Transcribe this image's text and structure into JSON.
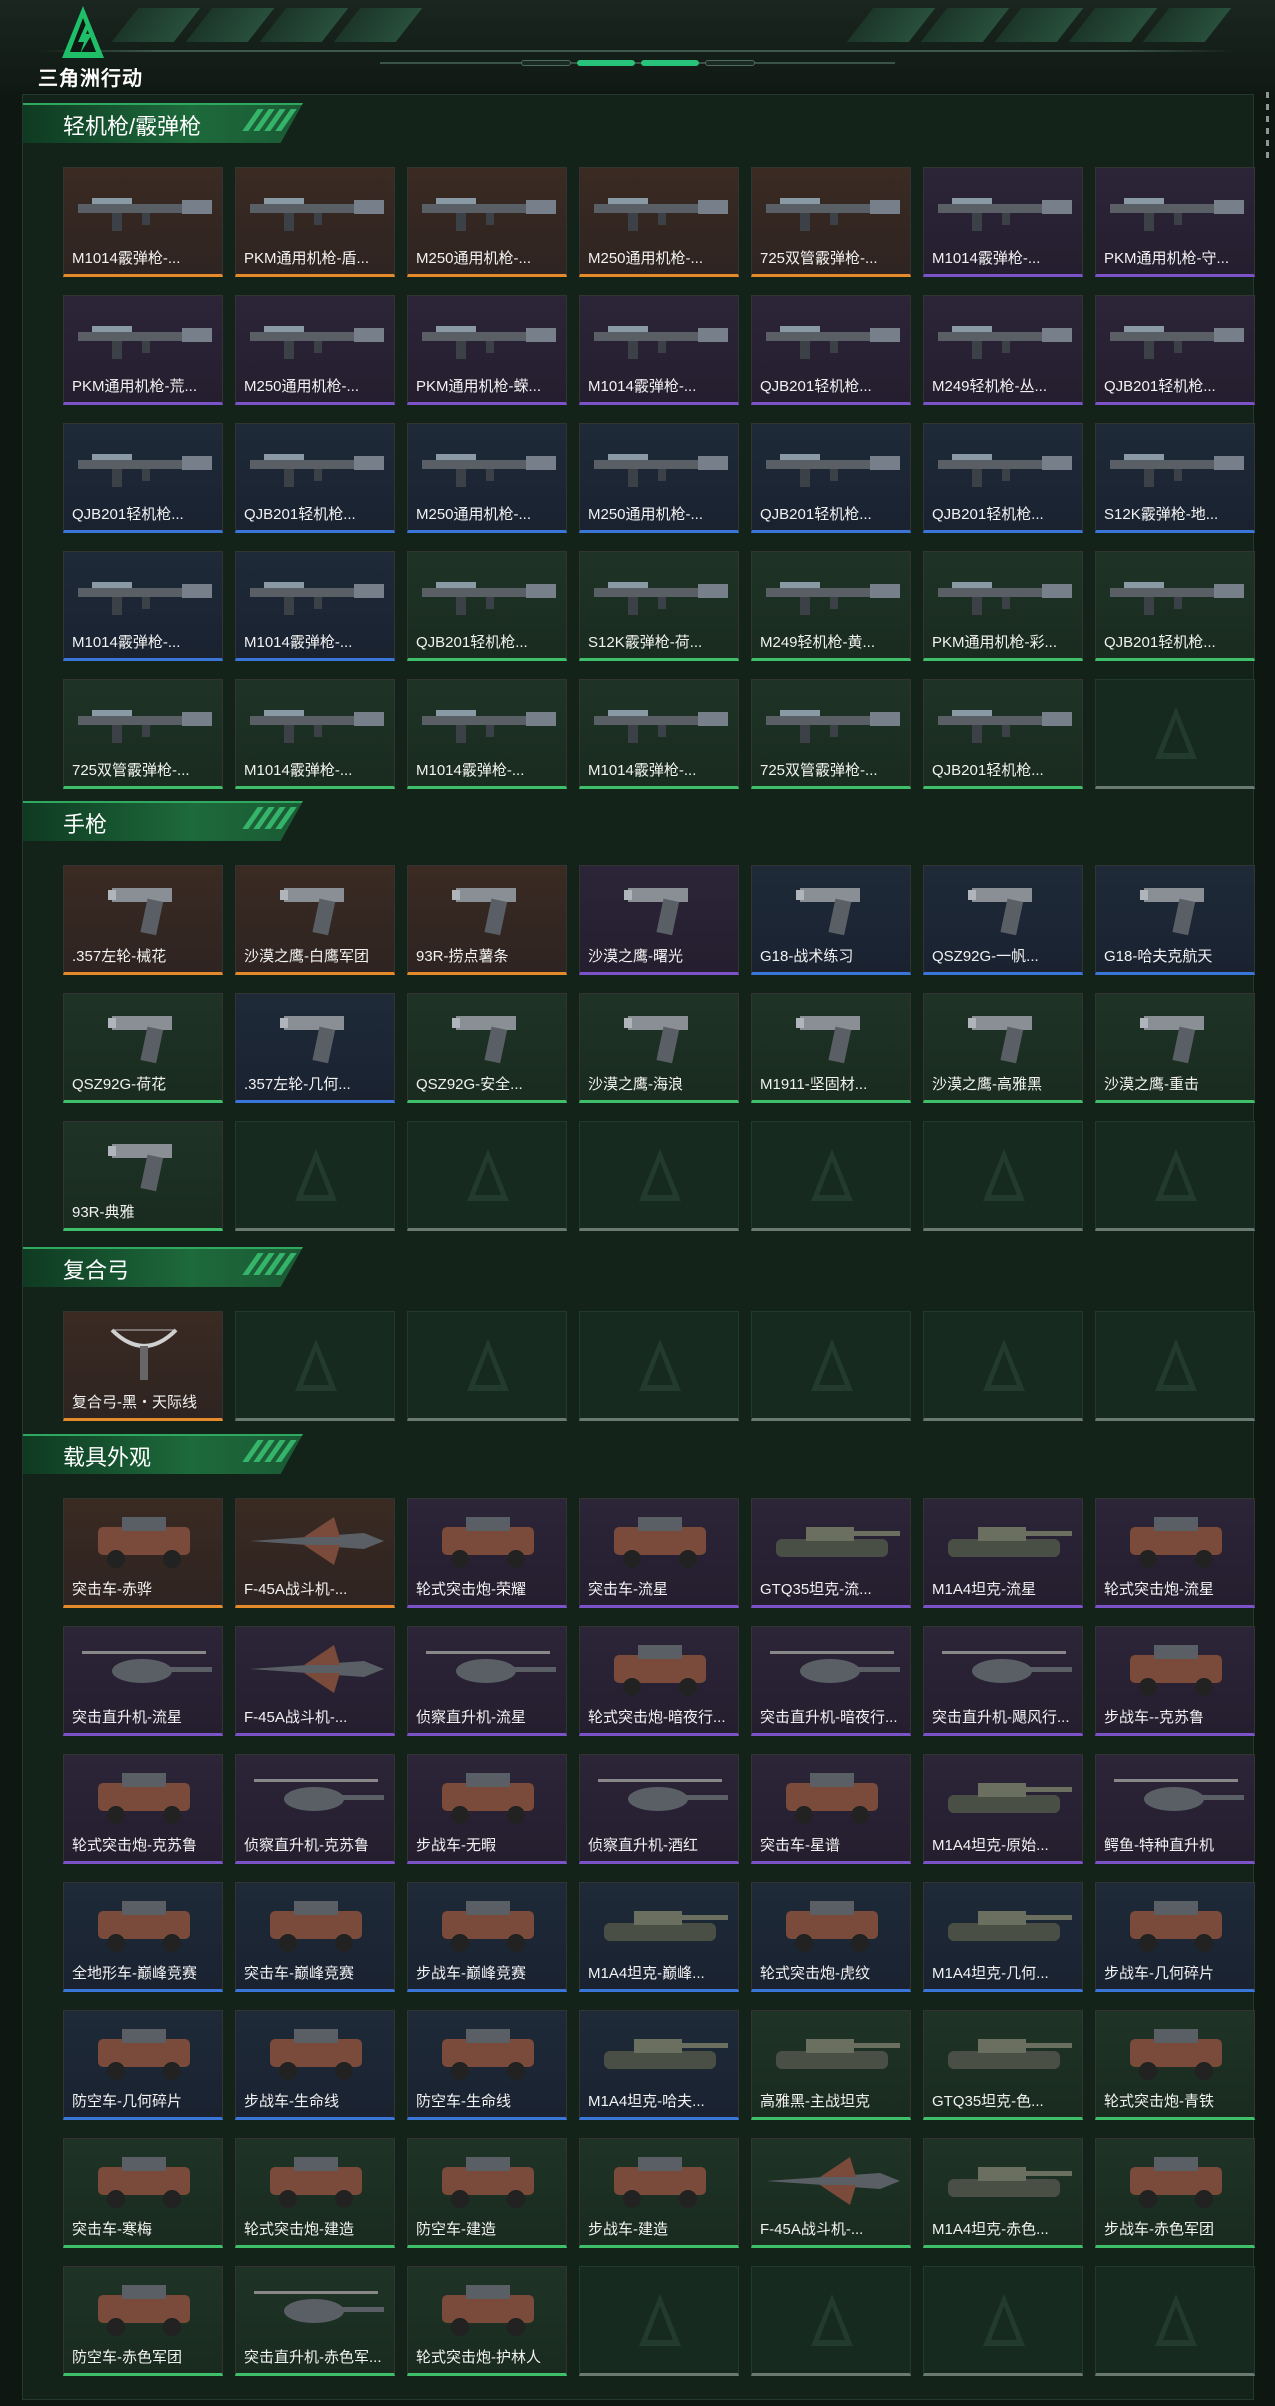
{
  "app": {
    "logo_text": "三角洲行动",
    "logo_icon": "delta-triangle-icon"
  },
  "sections": [
    {
      "title": "轻机枪/霰弹枪",
      "items": [
        {
          "label": "M1014霰弹枪-...",
          "rarity": "orange",
          "kind": "gun"
        },
        {
          "label": "PKM通用机枪-盾...",
          "rarity": "orange",
          "kind": "gun"
        },
        {
          "label": "M250通用机枪-...",
          "rarity": "orange",
          "kind": "gun"
        },
        {
          "label": "M250通用机枪-...",
          "rarity": "orange",
          "kind": "gun"
        },
        {
          "label": "725双管霰弹枪-...",
          "rarity": "orange",
          "kind": "gun"
        },
        {
          "label": "M1014霰弹枪-...",
          "rarity": "purple",
          "kind": "gun"
        },
        {
          "label": "PKM通用机枪-守...",
          "rarity": "purple",
          "kind": "gun"
        },
        {
          "label": "PKM通用机枪-荒...",
          "rarity": "purple",
          "kind": "gun"
        },
        {
          "label": "M250通用机枪-...",
          "rarity": "purple",
          "kind": "gun"
        },
        {
          "label": "PKM通用机枪-蝾...",
          "rarity": "purple",
          "kind": "gun"
        },
        {
          "label": "M1014霰弹枪-...",
          "rarity": "purple",
          "kind": "gun"
        },
        {
          "label": "QJB201轻机枪...",
          "rarity": "purple",
          "kind": "gun"
        },
        {
          "label": "M249轻机枪-丛...",
          "rarity": "purple",
          "kind": "gun"
        },
        {
          "label": "QJB201轻机枪...",
          "rarity": "purple",
          "kind": "gun"
        },
        {
          "label": "QJB201轻机枪...",
          "rarity": "blue",
          "kind": "gun"
        },
        {
          "label": "QJB201轻机枪...",
          "rarity": "blue",
          "kind": "gun"
        },
        {
          "label": "M250通用机枪-...",
          "rarity": "blue",
          "kind": "gun"
        },
        {
          "label": "M250通用机枪-...",
          "rarity": "blue",
          "kind": "gun"
        },
        {
          "label": "QJB201轻机枪...",
          "rarity": "blue",
          "kind": "gun"
        },
        {
          "label": "QJB201轻机枪...",
          "rarity": "blue",
          "kind": "gun"
        },
        {
          "label": "S12K霰弹枪-地...",
          "rarity": "blue",
          "kind": "gun"
        },
        {
          "label": "M1014霰弹枪-...",
          "rarity": "blue",
          "kind": "gun"
        },
        {
          "label": "M1014霰弹枪-...",
          "rarity": "blue",
          "kind": "gun"
        },
        {
          "label": "QJB201轻机枪...",
          "rarity": "green",
          "kind": "gun"
        },
        {
          "label": "S12K霰弹枪-荷...",
          "rarity": "green",
          "kind": "gun"
        },
        {
          "label": "M249轻机枪-黄...",
          "rarity": "green",
          "kind": "gun"
        },
        {
          "label": "PKM通用机枪-彩...",
          "rarity": "green",
          "kind": "gun"
        },
        {
          "label": "QJB201轻机枪...",
          "rarity": "green",
          "kind": "gun"
        },
        {
          "label": "725双管霰弹枪-...",
          "rarity": "green",
          "kind": "gun"
        },
        {
          "label": "M1014霰弹枪-...",
          "rarity": "green",
          "kind": "gun"
        },
        {
          "label": "M1014霰弹枪-...",
          "rarity": "green",
          "kind": "gun"
        },
        {
          "label": "M1014霰弹枪-...",
          "rarity": "green",
          "kind": "gun"
        },
        {
          "label": "725双管霰弹枪-...",
          "rarity": "green",
          "kind": "gun"
        },
        {
          "label": "QJB201轻机枪...",
          "rarity": "green",
          "kind": "gun"
        },
        {
          "label": "",
          "rarity": "empty",
          "kind": "empty"
        }
      ]
    },
    {
      "title": "手枪",
      "items": [
        {
          "label": ".357左轮-械花",
          "rarity": "orange",
          "kind": "pistol"
        },
        {
          "label": "沙漠之鹰-白鹰军团",
          "rarity": "orange",
          "kind": "pistol"
        },
        {
          "label": "93R-捞点薯条",
          "rarity": "orange",
          "kind": "pistol"
        },
        {
          "label": "沙漠之鹰-曙光",
          "rarity": "purple",
          "kind": "pistol"
        },
        {
          "label": "G18-战术练习",
          "rarity": "blue",
          "kind": "pistol"
        },
        {
          "label": "QSZ92G-一帆...",
          "rarity": "blue",
          "kind": "pistol"
        },
        {
          "label": "G18-哈夫克航天",
          "rarity": "blue",
          "kind": "pistol"
        },
        {
          "label": "QSZ92G-荷花",
          "rarity": "green",
          "kind": "pistol"
        },
        {
          "label": ".357左轮-几何...",
          "rarity": "blue",
          "kind": "pistol"
        },
        {
          "label": "QSZ92G-安全...",
          "rarity": "green",
          "kind": "pistol"
        },
        {
          "label": "沙漠之鹰-海浪",
          "rarity": "green",
          "kind": "pistol"
        },
        {
          "label": "M1911-坚固材...",
          "rarity": "green",
          "kind": "pistol"
        },
        {
          "label": "沙漠之鹰-高雅黑",
          "rarity": "green",
          "kind": "pistol"
        },
        {
          "label": "沙漠之鹰-重击",
          "rarity": "green",
          "kind": "pistol"
        },
        {
          "label": "93R-典雅",
          "rarity": "green",
          "kind": "pistol"
        },
        {
          "label": "",
          "rarity": "empty",
          "kind": "empty"
        },
        {
          "label": "",
          "rarity": "empty",
          "kind": "empty"
        },
        {
          "label": "",
          "rarity": "empty",
          "kind": "empty"
        },
        {
          "label": "",
          "rarity": "empty",
          "kind": "empty"
        },
        {
          "label": "",
          "rarity": "empty",
          "kind": "empty"
        },
        {
          "label": "",
          "rarity": "empty",
          "kind": "empty"
        }
      ]
    },
    {
      "title": "复合弓",
      "items": [
        {
          "label": "复合弓-黑・天际线",
          "rarity": "orange",
          "kind": "bow"
        },
        {
          "label": "",
          "rarity": "empty",
          "kind": "empty"
        },
        {
          "label": "",
          "rarity": "empty",
          "kind": "empty"
        },
        {
          "label": "",
          "rarity": "empty",
          "kind": "empty"
        },
        {
          "label": "",
          "rarity": "empty",
          "kind": "empty"
        },
        {
          "label": "",
          "rarity": "empty",
          "kind": "empty"
        },
        {
          "label": "",
          "rarity": "empty",
          "kind": "empty"
        }
      ]
    },
    {
      "title": "载具外观",
      "items": [
        {
          "label": "突击车-赤骅",
          "rarity": "orange",
          "kind": "car"
        },
        {
          "label": "F-45A战斗机-...",
          "rarity": "orange",
          "kind": "jet"
        },
        {
          "label": "轮式突击炮-荣耀",
          "rarity": "purple",
          "kind": "car"
        },
        {
          "label": "突击车-流星",
          "rarity": "purple",
          "kind": "car"
        },
        {
          "label": "GTQ35坦克-流...",
          "rarity": "purple",
          "kind": "tank"
        },
        {
          "label": "M1A4坦克-流星",
          "rarity": "purple",
          "kind": "tank"
        },
        {
          "label": "轮式突击炮-流星",
          "rarity": "purple",
          "kind": "car"
        },
        {
          "label": "突击直升机-流星",
          "rarity": "purple",
          "kind": "heli"
        },
        {
          "label": "F-45A战斗机-...",
          "rarity": "purple",
          "kind": "jet"
        },
        {
          "label": "侦察直升机-流星",
          "rarity": "purple",
          "kind": "heli"
        },
        {
          "label": "轮式突击炮-暗夜行...",
          "rarity": "purple",
          "kind": "car"
        },
        {
          "label": "突击直升机-暗夜行...",
          "rarity": "purple",
          "kind": "heli"
        },
        {
          "label": "突击直升机-飓风行...",
          "rarity": "purple",
          "kind": "heli"
        },
        {
          "label": "步战车--克苏鲁",
          "rarity": "purple",
          "kind": "car"
        },
        {
          "label": "轮式突击炮-克苏鲁",
          "rarity": "purple",
          "kind": "car"
        },
        {
          "label": "侦察直升机-克苏鲁",
          "rarity": "purple",
          "kind": "heli"
        },
        {
          "label": "步战车-无暇",
          "rarity": "purple",
          "kind": "car"
        },
        {
          "label": "侦察直升机-酒红",
          "rarity": "purple",
          "kind": "heli"
        },
        {
          "label": "突击车-星谱",
          "rarity": "purple",
          "kind": "car"
        },
        {
          "label": "M1A4坦克-原始...",
          "rarity": "purple",
          "kind": "tank"
        },
        {
          "label": "鳄鱼-特种直升机",
          "rarity": "purple",
          "kind": "heli"
        },
        {
          "label": "全地形车-巅峰竞赛",
          "rarity": "blue",
          "kind": "car"
        },
        {
          "label": "突击车-巅峰竞赛",
          "rarity": "blue",
          "kind": "car"
        },
        {
          "label": "步战车-巅峰竞赛",
          "rarity": "blue",
          "kind": "car"
        },
        {
          "label": "M1A4坦克-巅峰...",
          "rarity": "blue",
          "kind": "tank"
        },
        {
          "label": "轮式突击炮-虎纹",
          "rarity": "blue",
          "kind": "car"
        },
        {
          "label": "M1A4坦克-几何...",
          "rarity": "blue",
          "kind": "tank"
        },
        {
          "label": "步战车-几何碎片",
          "rarity": "blue",
          "kind": "car"
        },
        {
          "label": "防空车-几何碎片",
          "rarity": "blue",
          "kind": "car"
        },
        {
          "label": "步战车-生命线",
          "rarity": "blue",
          "kind": "car"
        },
        {
          "label": "防空车-生命线",
          "rarity": "blue",
          "kind": "car"
        },
        {
          "label": "M1A4坦克-哈夫...",
          "rarity": "blue",
          "kind": "tank"
        },
        {
          "label": "高雅黑-主战坦克",
          "rarity": "green",
          "kind": "tank"
        },
        {
          "label": "GTQ35坦克-色...",
          "rarity": "green",
          "kind": "tank"
        },
        {
          "label": "轮式突击炮-青铁",
          "rarity": "green",
          "kind": "car"
        },
        {
          "label": "突击车-寒梅",
          "rarity": "green",
          "kind": "car"
        },
        {
          "label": "轮式突击炮-建造",
          "rarity": "green",
          "kind": "car"
        },
        {
          "label": "防空车-建造",
          "rarity": "green",
          "kind": "car"
        },
        {
          "label": "步战车-建造",
          "rarity": "green",
          "kind": "car"
        },
        {
          "label": "F-45A战斗机-...",
          "rarity": "green",
          "kind": "jet"
        },
        {
          "label": "M1A4坦克-赤色...",
          "rarity": "green",
          "kind": "tank"
        },
        {
          "label": "步战车-赤色军团",
          "rarity": "green",
          "kind": "car"
        },
        {
          "label": "防空车-赤色军团",
          "rarity": "green",
          "kind": "car"
        },
        {
          "label": "突击直升机-赤色军...",
          "rarity": "green",
          "kind": "heli"
        },
        {
          "label": "轮式突击炮-护林人",
          "rarity": "green",
          "kind": "car"
        },
        {
          "label": "",
          "rarity": "empty",
          "kind": "empty"
        },
        {
          "label": "",
          "rarity": "empty",
          "kind": "empty"
        },
        {
          "label": "",
          "rarity": "empty",
          "kind": "empty"
        },
        {
          "label": "",
          "rarity": "empty",
          "kind": "empty"
        }
      ]
    }
  ],
  "colors": {
    "orange": "#e48a2a",
    "purple": "#7b52c7",
    "blue": "#3a76d8",
    "green": "#3fbf6a",
    "accent": "#27c37a"
  }
}
